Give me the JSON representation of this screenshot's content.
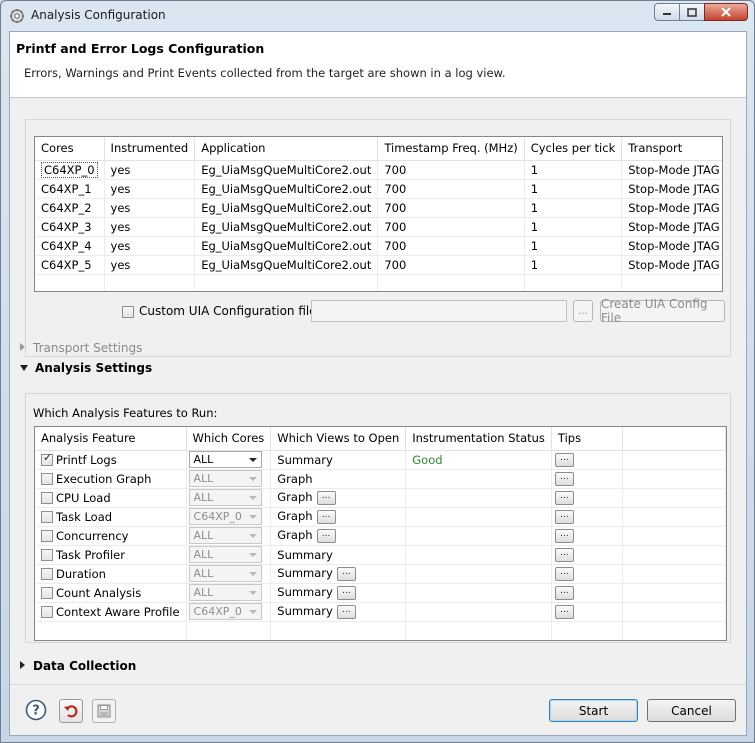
{
  "window": {
    "title": "Analysis Configuration"
  },
  "banner": {
    "title": "Printf and Error Logs Configuration",
    "subtitle": "Errors, Warnings and Print Events collected from the target are shown in a log view."
  },
  "cores_table": {
    "headers": [
      "Cores",
      "Instrumented",
      "Application",
      "Timestamp Freq. (MHz)",
      "Cycles per tick",
      "Transport"
    ],
    "rows": [
      [
        "C64XP_0",
        "yes",
        "Eg_UiaMsgQueMultiCore2.out",
        "700",
        "1",
        "Stop-Mode JTAG"
      ],
      [
        "C64XP_1",
        "yes",
        "Eg_UiaMsgQueMultiCore2.out",
        "700",
        "1",
        "Stop-Mode JTAG"
      ],
      [
        "C64XP_2",
        "yes",
        "Eg_UiaMsgQueMultiCore2.out",
        "700",
        "1",
        "Stop-Mode JTAG"
      ],
      [
        "C64XP_3",
        "yes",
        "Eg_UiaMsgQueMultiCore2.out",
        "700",
        "1",
        "Stop-Mode JTAG"
      ],
      [
        "C64XP_4",
        "yes",
        "Eg_UiaMsgQueMultiCore2.out",
        "700",
        "1",
        "Stop-Mode JTAG"
      ],
      [
        "C64XP_5",
        "yes",
        "Eg_UiaMsgQueMultiCore2.out",
        "700",
        "1",
        "Stop-Mode JTAG"
      ]
    ]
  },
  "custom_uia": {
    "label": "Custom UIA Configuration file:",
    "value": "",
    "browse_label": "...",
    "create_label": "Create UIA Config File"
  },
  "sections": {
    "transport": "Transport Settings",
    "analysis": "Analysis Settings",
    "data_collection": "Data Collection"
  },
  "analysis": {
    "prompt": "Which Analysis Features to Run:",
    "headers": [
      "Analysis Feature",
      "Which Cores",
      "Which Views to Open",
      "Instrumentation Status",
      "Tips"
    ],
    "rows": [
      {
        "feature": "Printf Logs",
        "checked": true,
        "cores": "ALL",
        "enabled": true,
        "views": "Summary",
        "views_btn": false,
        "status": "Good",
        "tips": "..."
      },
      {
        "feature": "Execution Graph",
        "checked": false,
        "cores": "ALL",
        "enabled": false,
        "views": "Graph",
        "views_btn": false,
        "status": "",
        "tips": "..."
      },
      {
        "feature": "CPU Load",
        "checked": false,
        "cores": "ALL",
        "enabled": false,
        "views": "Graph",
        "views_btn": true,
        "status": "",
        "tips": "..."
      },
      {
        "feature": "Task Load",
        "checked": false,
        "cores": "C64XP_0",
        "enabled": false,
        "views": "Graph",
        "views_btn": true,
        "status": "",
        "tips": "..."
      },
      {
        "feature": "Concurrency",
        "checked": false,
        "cores": "ALL",
        "enabled": false,
        "views": "Graph",
        "views_btn": true,
        "status": "",
        "tips": "..."
      },
      {
        "feature": "Task Profiler",
        "checked": false,
        "cores": "ALL",
        "enabled": false,
        "views": "Summary",
        "views_btn": false,
        "status": "",
        "tips": "..."
      },
      {
        "feature": "Duration",
        "checked": false,
        "cores": "ALL",
        "enabled": false,
        "views": "Summary",
        "views_btn": true,
        "status": "",
        "tips": "..."
      },
      {
        "feature": "Count Analysis",
        "checked": false,
        "cores": "ALL",
        "enabled": false,
        "views": "Summary",
        "views_btn": true,
        "status": "",
        "tips": "..."
      },
      {
        "feature": "Context Aware Profile",
        "checked": false,
        "cores": "C64XP_0",
        "enabled": false,
        "views": "Summary",
        "views_btn": true,
        "status": "",
        "tips": "..."
      }
    ]
  },
  "footer": {
    "start_label": "Start",
    "cancel_label": "Cancel"
  },
  "icons": {
    "help": "help-icon",
    "restore": "restore-defaults-icon",
    "save": "save-icon"
  },
  "colors": {
    "status_good": "#2d8a2d"
  }
}
